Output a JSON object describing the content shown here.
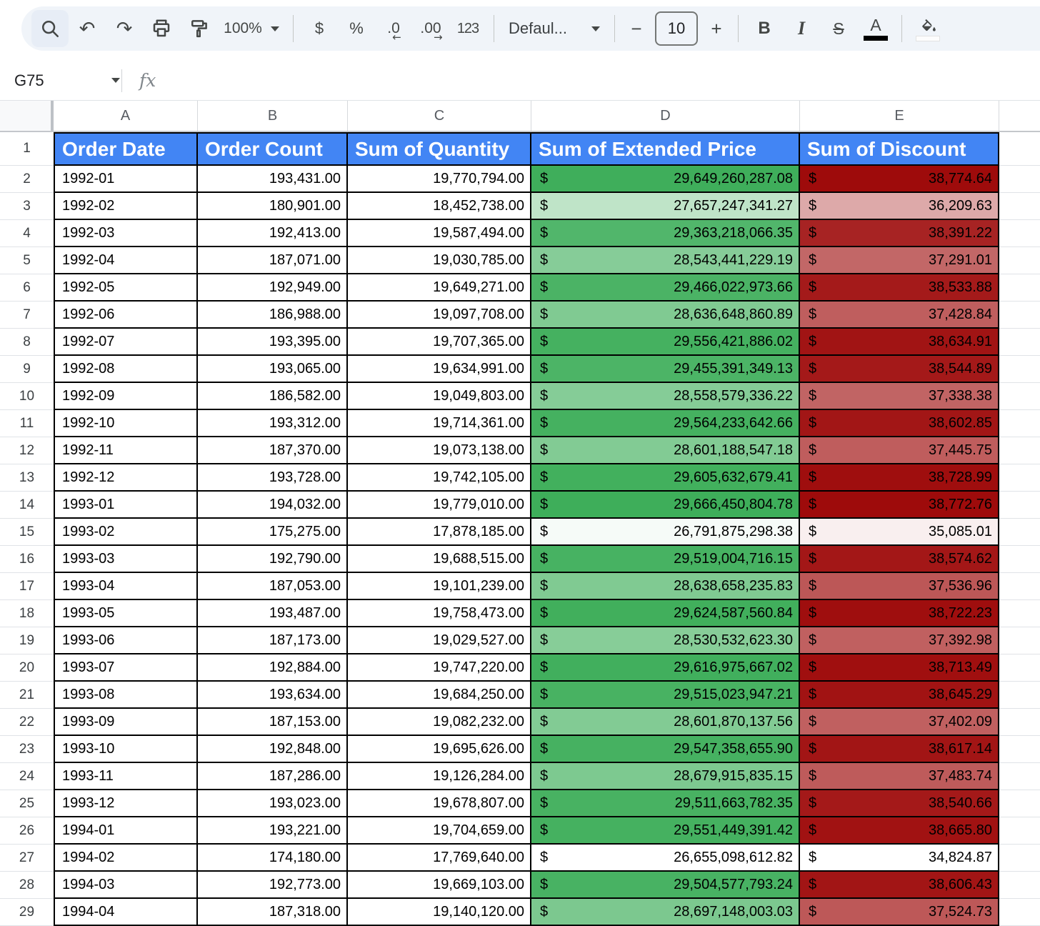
{
  "toolbar": {
    "zoom_value": "100%",
    "currency_label": "$",
    "percent_label": "%",
    "decrease_decimal_label": ".0",
    "increase_decimal_label": ".00",
    "more_formats_label": "123",
    "font_name": "Defaul...",
    "font_size": "10",
    "minus_label": "−",
    "plus_label": "+",
    "bold_label": "B",
    "italic_label": "I",
    "strikethrough_label": "S",
    "text_color_label": "A",
    "icons": {
      "undo": "↶",
      "redo": "↷",
      "decrease_arrow": "←",
      "increase_arrow": "→"
    }
  },
  "formula_bar": {
    "cell_reference": "G75",
    "fx_label": "fx"
  },
  "grid": {
    "column_letters": [
      "A",
      "B",
      "C",
      "D",
      "E",
      ""
    ],
    "currency_symbol": "$",
    "header": {
      "n": "1",
      "labels": [
        "Order Date",
        "Order Count",
        "Sum of Quantity",
        "Sum of Extended Price",
        "Sum of Discount"
      ],
      "bg": "#4285f4",
      "text_color": "#ffffff"
    },
    "rows": [
      {
        "n": "2",
        "date": "1992-01",
        "count": "193,431.00",
        "qty": "19,770,794.00",
        "ext": "29,649,260,287.08",
        "disc": "38,774.64"
      },
      {
        "n": "3",
        "date": "1992-02",
        "count": "180,901.00",
        "qty": "18,452,738.00",
        "ext": "27,657,247,341.27",
        "disc": "36,209.63"
      },
      {
        "n": "4",
        "date": "1992-03",
        "count": "192,413.00",
        "qty": "19,587,494.00",
        "ext": "29,363,218,066.35",
        "disc": "38,391.22"
      },
      {
        "n": "5",
        "date": "1992-04",
        "count": "187,071.00",
        "qty": "19,030,785.00",
        "ext": "28,543,441,229.19",
        "disc": "37,291.01"
      },
      {
        "n": "6",
        "date": "1992-05",
        "count": "192,949.00",
        "qty": "19,649,271.00",
        "ext": "29,466,022,973.66",
        "disc": "38,533.88"
      },
      {
        "n": "7",
        "date": "1992-06",
        "count": "186,988.00",
        "qty": "19,097,708.00",
        "ext": "28,636,648,860.89",
        "disc": "37,428.84"
      },
      {
        "n": "8",
        "date": "1992-07",
        "count": "193,395.00",
        "qty": "19,707,365.00",
        "ext": "29,556,421,886.02",
        "disc": "38,634.91"
      },
      {
        "n": "9",
        "date": "1992-08",
        "count": "193,065.00",
        "qty": "19,634,991.00",
        "ext": "29,455,391,349.13",
        "disc": "38,544.89"
      },
      {
        "n": "10",
        "date": "1992-09",
        "count": "186,582.00",
        "qty": "19,049,803.00",
        "ext": "28,558,579,336.22",
        "disc": "37,338.38"
      },
      {
        "n": "11",
        "date": "1992-10",
        "count": "193,312.00",
        "qty": "19,714,361.00",
        "ext": "29,564,233,642.66",
        "disc": "38,602.85"
      },
      {
        "n": "12",
        "date": "1992-11",
        "count": "187,370.00",
        "qty": "19,073,138.00",
        "ext": "28,601,188,547.18",
        "disc": "37,445.75"
      },
      {
        "n": "13",
        "date": "1992-12",
        "count": "193,728.00",
        "qty": "19,742,105.00",
        "ext": "29,605,632,679.41",
        "disc": "38,728.99"
      },
      {
        "n": "14",
        "date": "1993-01",
        "count": "194,032.00",
        "qty": "19,779,010.00",
        "ext": "29,666,450,804.78",
        "disc": "38,772.76"
      },
      {
        "n": "15",
        "date": "1993-02",
        "count": "175,275.00",
        "qty": "17,878,185.00",
        "ext": "26,791,875,298.38",
        "disc": "35,085.01"
      },
      {
        "n": "16",
        "date": "1993-03",
        "count": "192,790.00",
        "qty": "19,688,515.00",
        "ext": "29,519,004,716.15",
        "disc": "38,574.62"
      },
      {
        "n": "17",
        "date": "1993-04",
        "count": "187,053.00",
        "qty": "19,101,239.00",
        "ext": "28,638,658,235.83",
        "disc": "37,536.96"
      },
      {
        "n": "18",
        "date": "1993-05",
        "count": "193,487.00",
        "qty": "19,758,473.00",
        "ext": "29,624,587,560.84",
        "disc": "38,722.23"
      },
      {
        "n": "19",
        "date": "1993-06",
        "count": "187,173.00",
        "qty": "19,029,527.00",
        "ext": "28,530,532,623.30",
        "disc": "37,392.98"
      },
      {
        "n": "20",
        "date": "1993-07",
        "count": "192,884.00",
        "qty": "19,747,220.00",
        "ext": "29,616,975,667.02",
        "disc": "38,713.49"
      },
      {
        "n": "21",
        "date": "1993-08",
        "count": "193,634.00",
        "qty": "19,684,250.00",
        "ext": "29,515,023,947.21",
        "disc": "38,645.29"
      },
      {
        "n": "22",
        "date": "1993-09",
        "count": "187,153.00",
        "qty": "19,082,232.00",
        "ext": "28,601,870,137.56",
        "disc": "37,402.09"
      },
      {
        "n": "23",
        "date": "1993-10",
        "count": "192,848.00",
        "qty": "19,695,626.00",
        "ext": "29,547,358,655.90",
        "disc": "38,617.14"
      },
      {
        "n": "24",
        "date": "1993-11",
        "count": "187,286.00",
        "qty": "19,126,284.00",
        "ext": "28,679,915,835.15",
        "disc": "37,483.74"
      },
      {
        "n": "25",
        "date": "1993-12",
        "count": "193,023.00",
        "qty": "19,678,807.00",
        "ext": "29,511,663,782.35",
        "disc": "38,540.66"
      },
      {
        "n": "26",
        "date": "1994-01",
        "count": "193,221.00",
        "qty": "19,704,659.00",
        "ext": "29,551,449,391.42",
        "disc": "38,665.80"
      },
      {
        "n": "27",
        "date": "1994-02",
        "count": "174,180.00",
        "qty": "17,769,640.00",
        "ext": "26,655,098,612.82",
        "disc": "34,824.87"
      },
      {
        "n": "28",
        "date": "1994-03",
        "count": "192,773.00",
        "qty": "19,669,103.00",
        "ext": "29,504,577,793.24",
        "disc": "38,606.43"
      },
      {
        "n": "29",
        "date": "1994-04",
        "count": "187,318.00",
        "qty": "19,140,120.00",
        "ext": "28,697,148,003.03",
        "disc": "37,524.73"
      }
    ],
    "conditional_formatting": {
      "extended_price": {
        "min_color": "#ffffff",
        "max_color": "#3eae5a"
      },
      "discount": {
        "min_color": "#ffffff",
        "max_color": "#9e0b0b"
      }
    }
  }
}
